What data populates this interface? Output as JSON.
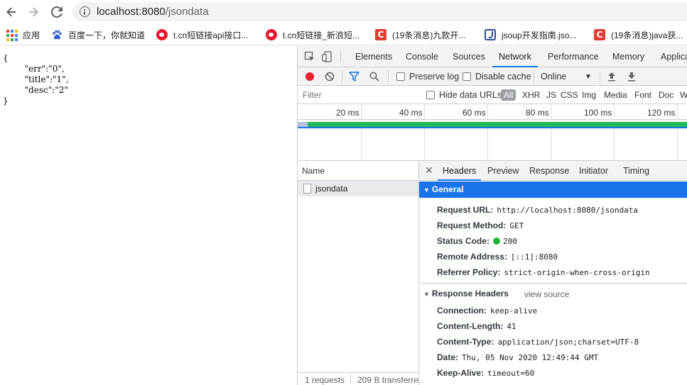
{
  "browser": {
    "url_host": "localhost:8080",
    "url_path": "/jsondata"
  },
  "bookmarks": [
    {
      "label": "应用",
      "icon": "apps-icon"
    },
    {
      "label": "百度一下，你就知道",
      "icon": "baidu-icon"
    },
    {
      "label": "t.cn短链接api接口...",
      "icon": "weibo-icon"
    },
    {
      "label": "t.cn短链接_新浪短...",
      "icon": "weibo-icon"
    },
    {
      "label": "(19条消息)九款开...",
      "icon": "csdn-icon"
    },
    {
      "label": "jsoup开发指南.jso...",
      "icon": "jsoup-icon"
    },
    {
      "label": "(19条消息)java获...",
      "icon": "csdn-icon"
    }
  ],
  "page": {
    "json_text": "{\n        \"err\":\"0\",\n        \"title\":\"1\",\n        \"desc\":\"2\"\n}"
  },
  "devtools": {
    "tabs": [
      "Elements",
      "Console",
      "Sources",
      "Network",
      "Performance",
      "Memory",
      "Applica"
    ],
    "active_tab": "Network",
    "toolbar": {
      "preserve_log": "Preserve log",
      "disable_cache": "Disable cache",
      "throttling": "Online"
    },
    "filter": {
      "placeholder": "Filter",
      "hide_data_urls": "Hide data URLs",
      "types": [
        "All",
        "XHR",
        "JS",
        "CSS",
        "Img",
        "Media",
        "Font",
        "Doc",
        "W"
      ]
    },
    "timeline_ticks": [
      "20 ms",
      "40 ms",
      "60 ms",
      "80 ms",
      "100 ms",
      "120 ms"
    ],
    "name_header": "Name",
    "requests": [
      {
        "name": "jsondata"
      }
    ],
    "status_bar": {
      "requests": "1 requests",
      "transferred": "209 B transferre"
    },
    "detail_tabs": [
      "Headers",
      "Preview",
      "Response",
      "Initiator",
      "Timing"
    ],
    "active_detail_tab": "Headers",
    "general": {
      "title": "General",
      "rows": [
        {
          "key": "Request URL:",
          "value": "http://localhost:8080/jsondata"
        },
        {
          "key": "Request Method:",
          "value": "GET"
        },
        {
          "key": "Status Code:",
          "value": "200"
        },
        {
          "key": "Remote Address:",
          "value": "[::1]:8080"
        },
        {
          "key": "Referrer Policy:",
          "value": "strict-origin-when-cross-origin"
        }
      ]
    },
    "response_headers": {
      "title": "Response Headers",
      "view_source": "view source",
      "rows": [
        {
          "key": "Connection:",
          "value": "keep-alive"
        },
        {
          "key": "Content-Length:",
          "value": "41"
        },
        {
          "key": "Content-Type:",
          "value": "application/json;charset=UTF-8"
        },
        {
          "key": "Date:",
          "value": "Thu, 05 Nov 2020 12:49:44 GMT"
        },
        {
          "key": "Keep-Alive:",
          "value": "timeout=60"
        }
      ]
    },
    "colors": {
      "accent": "#1a73e8",
      "status_ok": "#1eb53a",
      "record": "#e8212d"
    }
  }
}
